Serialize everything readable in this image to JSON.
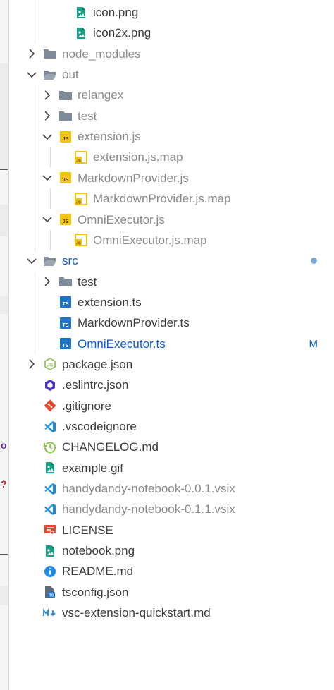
{
  "left_strip": {
    "glyphs": [
      "o",
      "?"
    ],
    "glyph_colors": [
      "#6b2fb3",
      "#c0273b"
    ]
  },
  "explorer": {
    "items": [
      {
        "label": "icon.png",
        "icon": "image-icon",
        "indent": 2,
        "twisty": "none",
        "style": "normal"
      },
      {
        "label": "icon2x.png",
        "icon": "image-icon",
        "indent": 2,
        "twisty": "none",
        "style": "normal"
      },
      {
        "label": "node_modules",
        "icon": "folder-icon",
        "indent": 0,
        "twisty": "closed",
        "style": "dim"
      },
      {
        "label": "out",
        "icon": "folder-open-icon",
        "indent": 0,
        "twisty": "open",
        "style": "dim"
      },
      {
        "label": "relangex",
        "icon": "folder-icon",
        "indent": 1,
        "twisty": "closed",
        "style": "dim"
      },
      {
        "label": "test",
        "icon": "folder-icon",
        "indent": 1,
        "twisty": "closed",
        "style": "dim"
      },
      {
        "label": "extension.js",
        "icon": "js-icon",
        "indent": 1,
        "twisty": "open",
        "style": "dim"
      },
      {
        "label": "extension.js.map",
        "icon": "js-map-icon",
        "indent": 2,
        "twisty": "none",
        "style": "dim"
      },
      {
        "label": "MarkdownProvider.js",
        "icon": "js-icon",
        "indent": 1,
        "twisty": "open",
        "style": "dim"
      },
      {
        "label": "MarkdownProvider.js.map",
        "icon": "js-map-icon",
        "indent": 2,
        "twisty": "none",
        "style": "dim"
      },
      {
        "label": "OmniExecutor.js",
        "icon": "js-icon",
        "indent": 1,
        "twisty": "open",
        "style": "dim"
      },
      {
        "label": "OmniExecutor.js.map",
        "icon": "js-map-icon",
        "indent": 2,
        "twisty": "none",
        "style": "dim"
      },
      {
        "label": "src",
        "icon": "folder-open-icon",
        "indent": 0,
        "twisty": "open",
        "style": "mod",
        "decoration": "dot"
      },
      {
        "label": "test",
        "icon": "folder-icon",
        "indent": 1,
        "twisty": "closed",
        "style": "normal"
      },
      {
        "label": "extension.ts",
        "icon": "ts-icon",
        "indent": 1,
        "twisty": "none",
        "style": "normal"
      },
      {
        "label": "MarkdownProvider.ts",
        "icon": "ts-icon",
        "indent": 1,
        "twisty": "none",
        "style": "normal"
      },
      {
        "label": "OmniExecutor.ts",
        "icon": "ts-icon",
        "indent": 1,
        "twisty": "none",
        "style": "mod",
        "decoration": "M"
      },
      {
        "label": "package.json",
        "icon": "node-json-icon",
        "indent": 0,
        "twisty": "closed",
        "style": "normal"
      },
      {
        "label": ".eslintrc.json",
        "icon": "eslint-icon",
        "indent": 0,
        "twisty": "none",
        "style": "normal"
      },
      {
        "label": ".gitignore",
        "icon": "git-icon",
        "indent": 0,
        "twisty": "none",
        "style": "normal"
      },
      {
        "label": ".vscodeignore",
        "icon": "vscode-icon",
        "indent": 0,
        "twisty": "none",
        "style": "normal"
      },
      {
        "label": "CHANGELOG.md",
        "icon": "changelog-icon",
        "indent": 0,
        "twisty": "none",
        "style": "normal"
      },
      {
        "label": "example.gif",
        "icon": "image-icon",
        "indent": 0,
        "twisty": "none",
        "style": "normal"
      },
      {
        "label": "handydandy-notebook-0.0.1.vsix",
        "icon": "vscode-icon",
        "indent": 0,
        "twisty": "none",
        "style": "dim"
      },
      {
        "label": "handydandy-notebook-0.1.1.vsix",
        "icon": "vscode-icon",
        "indent": 0,
        "twisty": "none",
        "style": "dim"
      },
      {
        "label": "LICENSE",
        "icon": "license-icon",
        "indent": 0,
        "twisty": "none",
        "style": "normal"
      },
      {
        "label": "notebook.png",
        "icon": "image-icon",
        "indent": 0,
        "twisty": "none",
        "style": "normal"
      },
      {
        "label": "README.md",
        "icon": "info-icon",
        "indent": 0,
        "twisty": "none",
        "style": "normal"
      },
      {
        "label": "tsconfig.json",
        "icon": "tsconfig-icon",
        "indent": 0,
        "twisty": "none",
        "style": "normal"
      },
      {
        "label": "vsc-extension-quickstart.md",
        "icon": "markdown-icon",
        "indent": 0,
        "twisty": "none",
        "style": "normal"
      }
    ]
  },
  "colors": {
    "modified": "#0b5ed7",
    "ignored_text": "#8a8a8a",
    "folder": "#7e8a98",
    "js": "#f1c40f",
    "ts": "#1f73c9",
    "image": "#16a085",
    "node": "#8bc34a",
    "eslint": "#4b32c3",
    "git": "#e8462c",
    "vscode": "#1f8ad2",
    "license": "#e8462c",
    "info": "#1e88e5"
  }
}
